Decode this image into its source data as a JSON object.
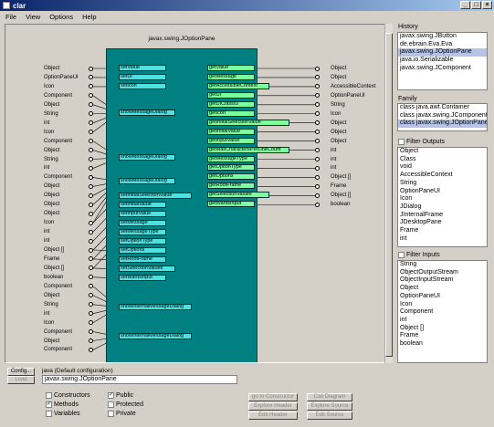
{
  "window": {
    "title": "clar",
    "min": "_",
    "max": "□",
    "close": "×"
  },
  "menu": [
    "File",
    "View",
    "Options",
    "Help"
  ],
  "diagram": {
    "class_name": "javax.swing.JOptionPane",
    "left_types": [
      "Object",
      "OptionPaneUI",
      "Icon",
      "Component",
      "Object",
      "String",
      "int",
      "Icon",
      "Component",
      "Object",
      "String",
      "int",
      "Component",
      "Object",
      "Object",
      "Object",
      "Object",
      "Icon",
      "int",
      "int",
      "Object []",
      "Frame",
      "Object []",
      "boolean",
      "Component",
      "Object",
      "String",
      "int",
      "Icon",
      "Component",
      "Object",
      "Component"
    ],
    "setters": [
      "setValue",
      "setUI",
      "setIcon",
      "showMessageDialog",
      "showMessageDialog",
      "showMessageDialog",
      "setInitialSelectionValue",
      "setInitialValue",
      "setInputValue",
      "setMessage",
      "setMessageType",
      "setOptionType",
      "setOptions",
      "setRootFrame",
      "setSelectionValues",
      "setWantsInput",
      "showInternalMessageDialog",
      "showInternalMessageDialog"
    ],
    "getters": [
      "getValue",
      "getMessage",
      "getAccessibleContext",
      "getUI",
      "getUIClassID",
      "getIcon",
      "getInitialSelectionValue",
      "getInitialValue",
      "getInputValue",
      "getMaxCharactersPerLineCount",
      "getMessageType",
      "getOptionType",
      "getOptions",
      "getRootFrame",
      "getSelectionValues",
      "getWantsInput"
    ],
    "right_types": [
      "Object",
      "Object",
      "AccessibleContext",
      "OptionPaneUI",
      "String",
      "Icon",
      "Object",
      "Object",
      "Object",
      "int",
      "int",
      "int",
      "Object []",
      "Frame",
      "Object []",
      "boolean"
    ]
  },
  "history": {
    "label": "History",
    "items": [
      "javax.swing.JButton",
      "de.ebrain.Eva.Eva",
      "javax.swing.JOptionPane",
      "java.io.Serializable",
      "javax.swing.JComponent"
    ],
    "selected": 2
  },
  "family": {
    "label": "Family",
    "items": [
      "class java.awt.Container",
      "class javax.swing.JComponent",
      "class javax.swing.JOptionPane"
    ],
    "selected": 2
  },
  "outputs": {
    "label": "Filter Outputs",
    "items": [
      "Object",
      "Class",
      "void",
      "AccessibleContext",
      "String",
      "OptionPaneUI",
      "Icon",
      "JDialog",
      "JInternalFrame",
      "JDesktopPane",
      "Frame",
      "int"
    ]
  },
  "inputs": {
    "label": "Filter Inputs",
    "items": [
      "String",
      "ObjectOutputStream",
      "ObjectInputStream",
      "Object",
      "OptionPaneUI",
      "Icon",
      "Component",
      "int",
      "Object []",
      "Frame",
      "boolean"
    ]
  },
  "bottom": {
    "config_button": "Config...",
    "config_text": "java (Default configuration)",
    "load_button": "Load",
    "class_field": "javax.swing.JOptionPane",
    "checks": [
      {
        "label": "Constructors",
        "checked": false
      },
      {
        "label": "Methods",
        "checked": true
      },
      {
        "label": "Variables",
        "checked": false
      },
      {
        "label": "Public",
        "checked": true
      },
      {
        "label": "Protected",
        "checked": false
      },
      {
        "label": "Private",
        "checked": false
      }
    ],
    "actions": [
      "go to Constructor",
      "Explore Header",
      "Edit Header",
      "Call Diagram",
      "Explore Source",
      "Edit Source"
    ]
  }
}
